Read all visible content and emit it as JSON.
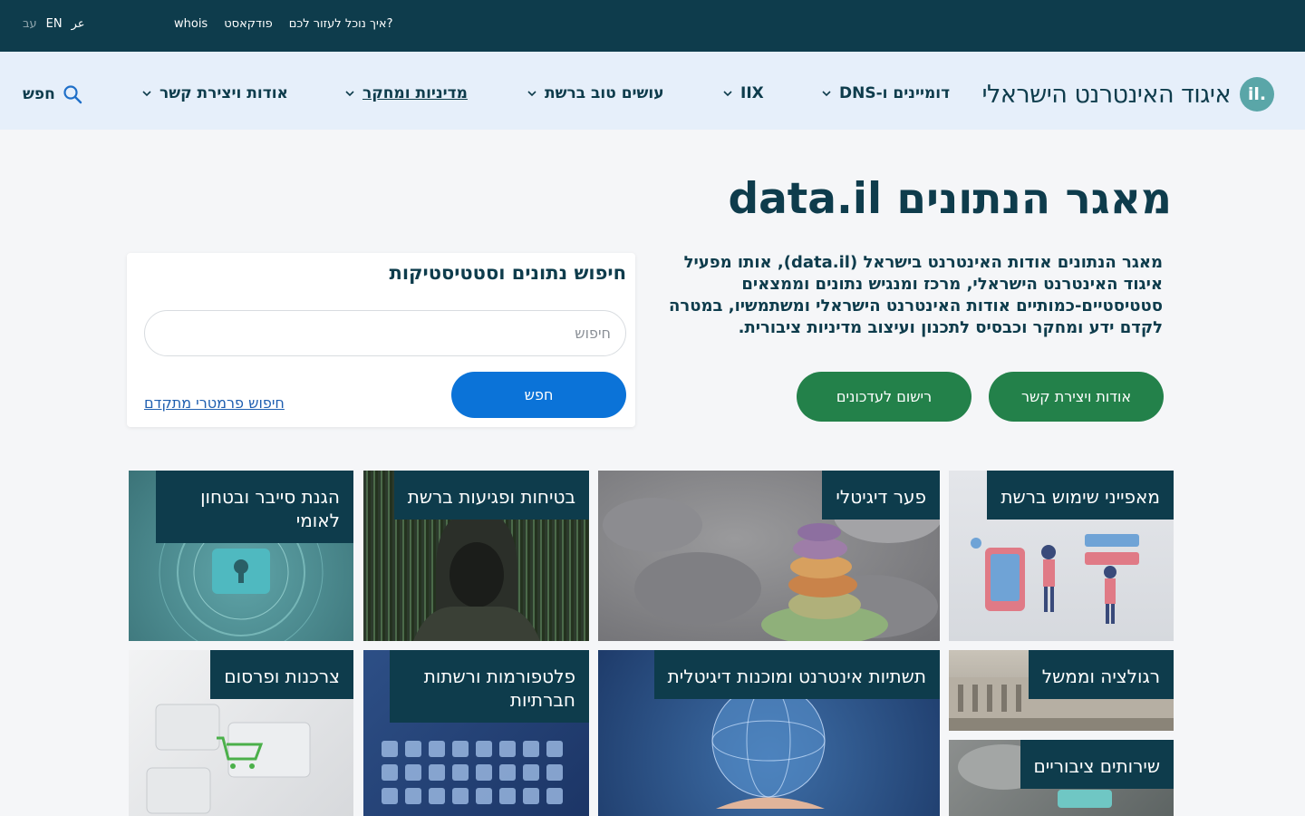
{
  "topbar": {
    "lang_ar": "عر",
    "lang_en": "EN",
    "lang_he": "עב",
    "utils": [
      "whois",
      "פודקאסט",
      "איך נוכל לעזור לכם?"
    ]
  },
  "nav": {
    "logo_badge": ".il",
    "logo_name": "איגוד האינטרנט הישראלי",
    "items": [
      "דומיינים ו-DNS",
      "IIX",
      "עושים טוב ברשת",
      "מדיניות ומחקר",
      "אודות ויצירת קשר"
    ],
    "search_label": "חפש"
  },
  "hero": {
    "title": "מאגר הנתונים data.il",
    "description": "מאגר הנתונים אודות האינטרנט בישראל (data.il), אותו מפעיל איגוד האינטרנט הישראלי, מרכז ומנגיש נתונים וממצאים סטטיסטיים-כמותיים אודות האינטרנט הישראלי ומשתמשיו, במטרה לקדם ידע ומחקר וכבסיס לתכנון ועיצוב מדיניות ציבורית.",
    "btn_about": "אודות ויצירת קשר",
    "btn_subscribe": "רישום לעדכונים"
  },
  "search_card": {
    "title": "חיפוש נתונים וסטטיסטיקות",
    "placeholder": "חיפוש",
    "button": "חפש",
    "advanced": "חיפוש פרמטרי מתקדם"
  },
  "tiles": [
    "מאפייני שימוש ברשת",
    "פער דיגיטלי",
    "בטיחות ופגיעות ברשת",
    "הגנת סייבר ובטחון לאומי",
    "רגולציה וממשל",
    "תשתיות אינטרנט ומוכנות דיגיטלית",
    "פלטפורמות ורשתות חברתיות",
    "צרכנות ופרסום",
    "שירותים ציבוריים"
  ],
  "colors": {
    "dark_teal": "#0e3c4c",
    "nav_bg": "#e6effa",
    "green": "#23814a",
    "blue": "#0b73d8"
  }
}
